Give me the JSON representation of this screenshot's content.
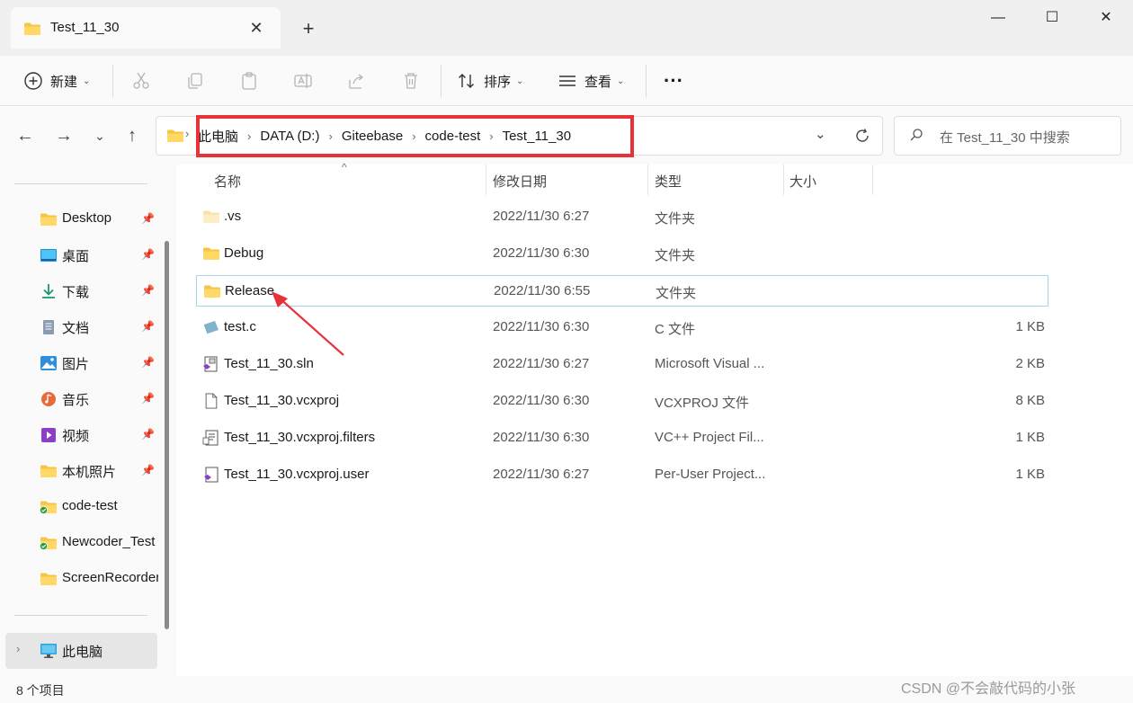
{
  "tab": {
    "title": "Test_11_30"
  },
  "window": {
    "minimize": "—",
    "maximize": "☐",
    "close": "✕"
  },
  "toolbar": {
    "new_label": "新建",
    "sort_label": "排序",
    "view_label": "查看",
    "more_label": "···"
  },
  "address": {
    "crumbs": [
      "此电脑",
      "DATA (D:)",
      "Giteebase",
      "code-test",
      "Test_11_30"
    ]
  },
  "search": {
    "placeholder": "在 Test_11_30 中搜索"
  },
  "sidebar": {
    "items": [
      {
        "label": "Desktop",
        "icon": "folder-icon",
        "pinned": true
      },
      {
        "label": "桌面",
        "icon": "desktop-icon",
        "pinned": true
      },
      {
        "label": "下载",
        "icon": "download-icon",
        "pinned": true
      },
      {
        "label": "文档",
        "icon": "document-icon",
        "pinned": true
      },
      {
        "label": "图片",
        "icon": "pictures-icon",
        "pinned": true
      },
      {
        "label": "音乐",
        "icon": "music-icon",
        "pinned": true
      },
      {
        "label": "视频",
        "icon": "video-icon",
        "pinned": true
      },
      {
        "label": "本机照片",
        "icon": "folder-icon",
        "pinned": true
      },
      {
        "label": "code-test",
        "icon": "synced-folder-icon",
        "pinned": false
      },
      {
        "label": "Newcoder_Test",
        "icon": "synced-folder-icon",
        "pinned": false
      },
      {
        "label": "ScreenRecorder",
        "icon": "folder-icon",
        "pinned": false
      }
    ],
    "this_pc": "此电脑"
  },
  "columns": {
    "name": "名称",
    "date": "修改日期",
    "type": "类型",
    "size": "大小"
  },
  "files": [
    {
      "name": ".vs",
      "date": "2022/11/30 6:27",
      "type": "文件夹",
      "size": "",
      "icon": "hidden-folder-icon"
    },
    {
      "name": "Debug",
      "date": "2022/11/30 6:30",
      "type": "文件夹",
      "size": "",
      "icon": "folder-icon"
    },
    {
      "name": "Release",
      "date": "2022/11/30 6:55",
      "type": "文件夹",
      "size": "",
      "icon": "folder-icon"
    },
    {
      "name": "test.c",
      "date": "2022/11/30 6:30",
      "type": "C 文件",
      "size": "1 KB",
      "icon": "c-file-icon"
    },
    {
      "name": "Test_11_30.sln",
      "date": "2022/11/30 6:27",
      "type": "Microsoft Visual ...",
      "size": "2 KB",
      "icon": "sln-file-icon"
    },
    {
      "name": "Test_11_30.vcxproj",
      "date": "2022/11/30 6:30",
      "type": "VCXPROJ 文件",
      "size": "8 KB",
      "icon": "blank-file-icon"
    },
    {
      "name": "Test_11_30.vcxproj.filters",
      "date": "2022/11/30 6:30",
      "type": "VC++ Project Fil...",
      "size": "1 KB",
      "icon": "filters-file-icon"
    },
    {
      "name": "Test_11_30.vcxproj.user",
      "date": "2022/11/30 6:27",
      "type": "Per-User Project...",
      "size": "1 KB",
      "icon": "user-file-icon"
    }
  ],
  "status": {
    "count": "8 个项目"
  },
  "watermark": "CSDN @不会敲代码的小张",
  "colors": {
    "highlight_box": "#e8323a",
    "folder": "#f6c544",
    "selection_border": "#a8d4e8"
  }
}
